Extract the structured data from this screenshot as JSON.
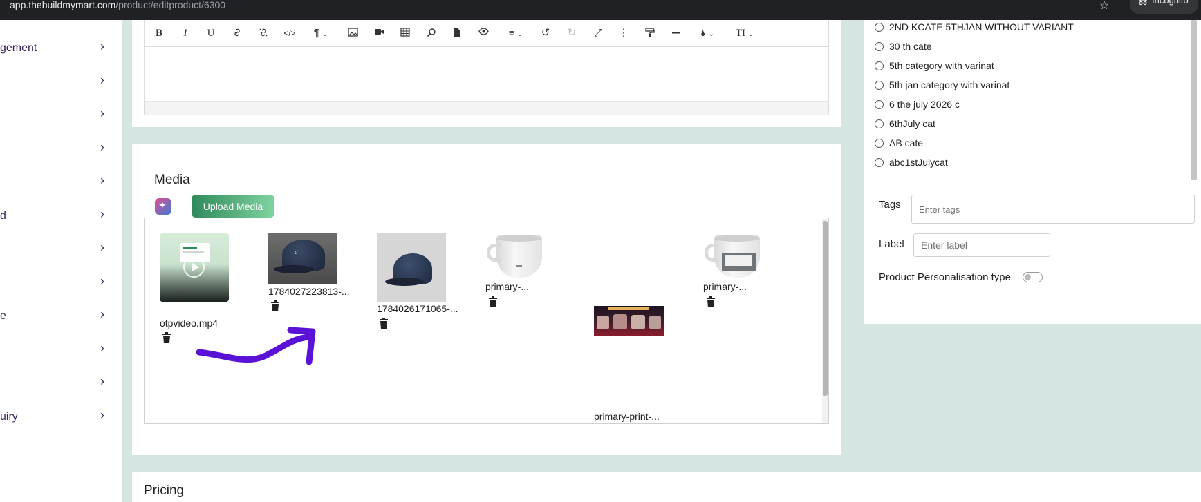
{
  "browser": {
    "url_domain": "app.thebuildmymart.com",
    "url_path": "/product/editproduct/6300",
    "profile_label": "Incognito"
  },
  "sidebar": {
    "items": [
      {
        "label": "gement"
      },
      {
        "label": ""
      },
      {
        "label": ""
      },
      {
        "label": ""
      },
      {
        "label": ""
      },
      {
        "label": "d"
      },
      {
        "label": ""
      },
      {
        "label": ""
      },
      {
        "label": "e"
      },
      {
        "label": ""
      },
      {
        "label": ""
      },
      {
        "label": "uiry"
      }
    ]
  },
  "editor": {
    "toolbar": [
      "bold-icon",
      "italic-icon",
      "underline-icon",
      "link-icon",
      "unlink-icon",
      "code-view-icon",
      "paragraph-icon",
      "image-icon",
      "video-icon",
      "table-icon",
      "find-icon",
      "file-icon",
      "preview-icon",
      "align-icon",
      "undo-icon",
      "redo-icon",
      "fullscreen-icon",
      "more-icon",
      "paint-format-icon",
      "horizontal-line-icon",
      "color-icon",
      "text-size-icon"
    ]
  },
  "media": {
    "title": "Media",
    "upload_label": "Upload Media",
    "items": [
      {
        "name": "otpvideo.mp4",
        "type": "video"
      },
      {
        "name": "1784027223813-...",
        "type": "image"
      },
      {
        "name": "1784026171065-...",
        "type": "image"
      },
      {
        "name": "primary-...",
        "type": "image"
      },
      {
        "name": "primary-print-...",
        "type": "image"
      },
      {
        "name": "primary-...",
        "type": "image"
      }
    ]
  },
  "categories": [
    "2ND KCATE 5THJAN WITHOUT VARIANT",
    "30 th cate",
    "5th category with varinat",
    "5th jan category with varinat",
    "6 the july 2026 c",
    "6thJuly cat",
    "AB cate",
    "abc1stJulycat"
  ],
  "tags": {
    "label": "Tags",
    "placeholder": "Enter tags"
  },
  "label_field": {
    "label": "Label",
    "placeholder": "Enter label"
  },
  "personalisation": {
    "label": "Product Personalisation type",
    "enabled": false
  },
  "pricing": {
    "title": "Pricing"
  },
  "colors": {
    "accent": "#2f8a5b",
    "background": "#d5e6e2",
    "sidebar_text": "#3b1f5c",
    "annotation_arrow": "#5a12d6"
  }
}
